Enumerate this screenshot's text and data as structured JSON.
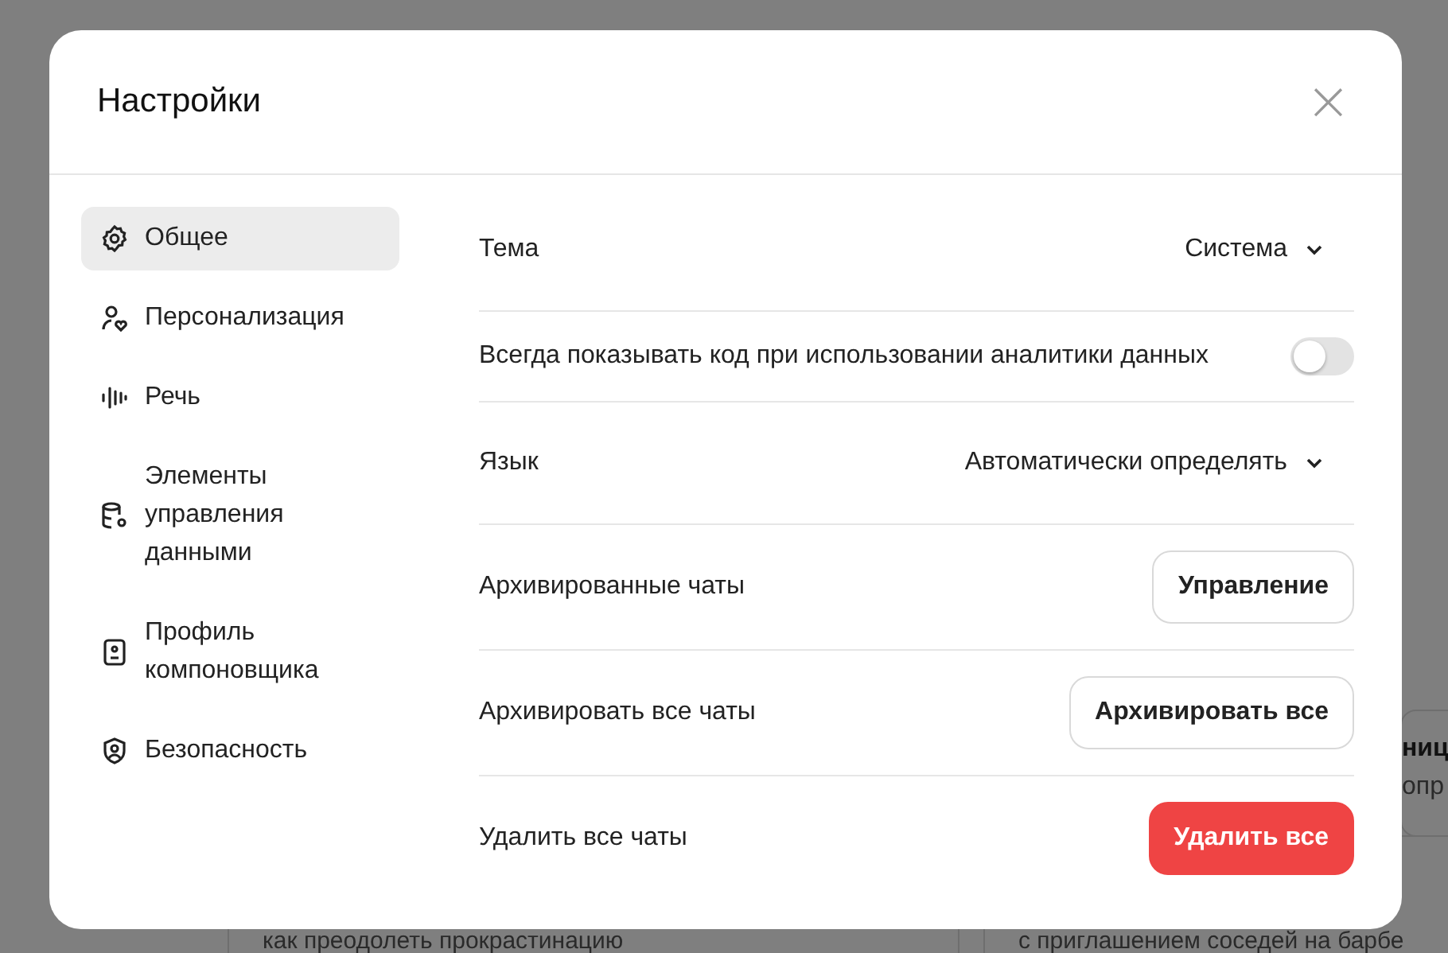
{
  "backdrop": {
    "cards": [
      {
        "kind": "side",
        "title": "ниц",
        "text": "опр"
      },
      {
        "kind": "bottom-left",
        "text": "как преодолеть прокрастинацию"
      },
      {
        "kind": "bottom-right",
        "text": "с приглашением соседей на барбе"
      }
    ]
  },
  "dialog": {
    "title": "Настройки",
    "close_label": "×"
  },
  "sidebar": {
    "items": [
      {
        "label": "Общее",
        "selected": true
      },
      {
        "label": "Персонализация",
        "selected": false
      },
      {
        "label": "Речь",
        "selected": false
      },
      {
        "label": "Элементы управления данными",
        "selected": false
      },
      {
        "label": "Профиль компоновщика",
        "selected": false
      },
      {
        "label": "Безопасность",
        "selected": false
      }
    ]
  },
  "settings": [
    {
      "kind": "dropdown",
      "label": "Тема",
      "value": "Система"
    },
    {
      "kind": "toggle",
      "label": "Всегда показывать код при использовании аналитики данных",
      "on": false
    },
    {
      "kind": "dropdown",
      "label": "Язык",
      "value": "Автоматически определять"
    },
    {
      "kind": "button",
      "label": "Архивированные чаты",
      "button": "Управление"
    },
    {
      "kind": "button",
      "label": "Архивировать все чаты",
      "button": "Архивировать все"
    },
    {
      "kind": "danger",
      "label": "Удалить все чаты",
      "button": "Удалить все"
    }
  ]
}
